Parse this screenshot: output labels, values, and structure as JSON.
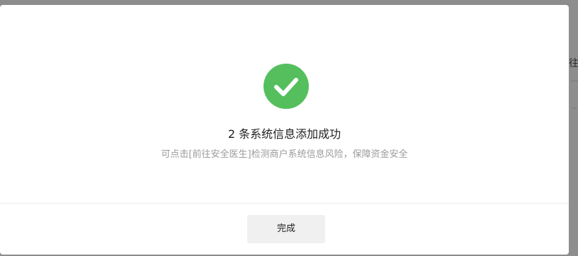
{
  "dialog": {
    "icon": "checkmark-circle-icon",
    "accent_color": "#55bf5e",
    "title": "2 条系统信息添加成功",
    "subtitle": "可点击[前往安全医生]检测商户系统信息风险，保障资金安全",
    "done_label": "完成"
  },
  "background": {
    "partial_text": "往安"
  }
}
